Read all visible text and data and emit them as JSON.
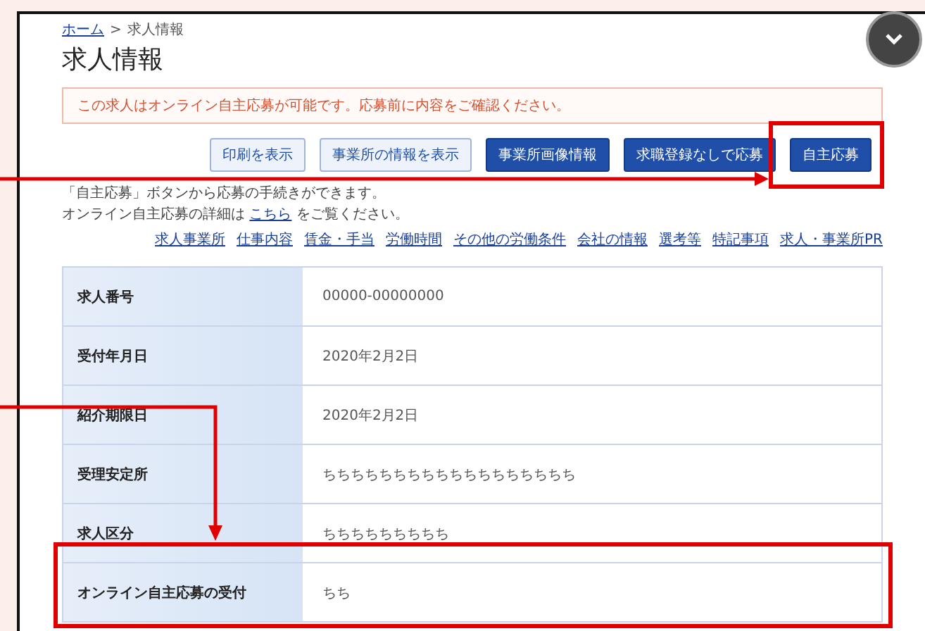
{
  "breadcrumb": [
    {
      "kind": "link",
      "label": "ホーム"
    },
    {
      "kind": "separator",
      "label": ">"
    },
    {
      "kind": "current",
      "label": "求人情報"
    }
  ],
  "title": "求人情報",
  "notice": "この求人はオンライン自主応募が可能です。応募前に内容をご確認ください。",
  "buttons": [
    {
      "label": "印刷を表示",
      "kind": "outline"
    },
    {
      "label": "事業所の情報を表示",
      "kind": "outline"
    },
    {
      "label": "事業所画像情報",
      "kind": "primary"
    },
    {
      "label": "求職登録なしで応募",
      "kind": "primary"
    },
    {
      "label": "自主応募",
      "kind": "primary"
    }
  ],
  "notes": [
    {
      "text": "「自主応募」ボタンから応募の手続きができます。"
    },
    {
      "text": "オンライン自主応募の詳細は",
      "link": "こちら",
      "after": "をご覧ください。"
    }
  ],
  "section_links": [
    "求人事業所",
    "仕事内容",
    "賃金・手当",
    "労働時間",
    "その他の労働条件",
    "会社の情報",
    "選考等",
    "特記事項",
    "求人・事業所PR"
  ],
  "rows": [
    {
      "label": "求人番号",
      "value": "00000-00000000"
    },
    {
      "label": "受付年月日",
      "value": "2020年2月2日"
    },
    {
      "label": "紹介期限日",
      "value": "2020年2月2日"
    },
    {
      "label": "受理安定所",
      "value": "ちちちちちちちちちちちちちちちちちち"
    },
    {
      "label": "求人区分",
      "value": "ちちちちちちちちち"
    },
    {
      "label": "オンライン自主応募の受付",
      "value": "ちち"
    }
  ]
}
